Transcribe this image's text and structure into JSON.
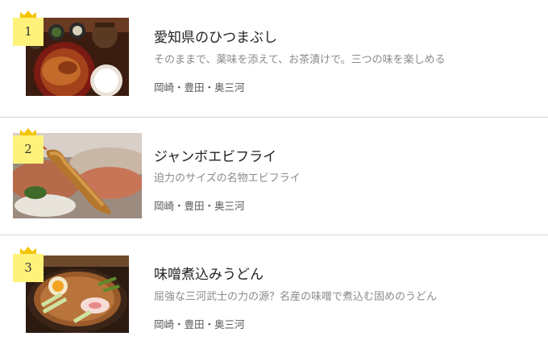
{
  "items": [
    {
      "rank": "1",
      "title": "愛知県のひつまぶし",
      "description": "そのままで、薬味を添えて、お茶漬けで。三つの味を楽しめる",
      "area": "岡崎・豊田・奥三河",
      "image": "hitsumabushi-photo",
      "rank_icon": "crown-icon"
    },
    {
      "rank": "2",
      "title": "ジャンボエビフライ",
      "description": "迫力のサイズの名物エビフライ",
      "area": "岡崎・豊田・奥三河",
      "image": "ebi-fry-photo",
      "rank_icon": "crown-icon"
    },
    {
      "rank": "3",
      "title": "味噌煮込みうどん",
      "description": "屈強な三河武士の力の源？名産の味噌で煮込む固めのうどん",
      "area": "岡崎・豊田・奥三河",
      "image": "miso-nikomi-udon-photo",
      "rank_icon": "crown-icon"
    }
  ],
  "colors": {
    "rank_badge": "#fff27a",
    "crown": "#f3c400",
    "divider": "#d6d6d6"
  }
}
